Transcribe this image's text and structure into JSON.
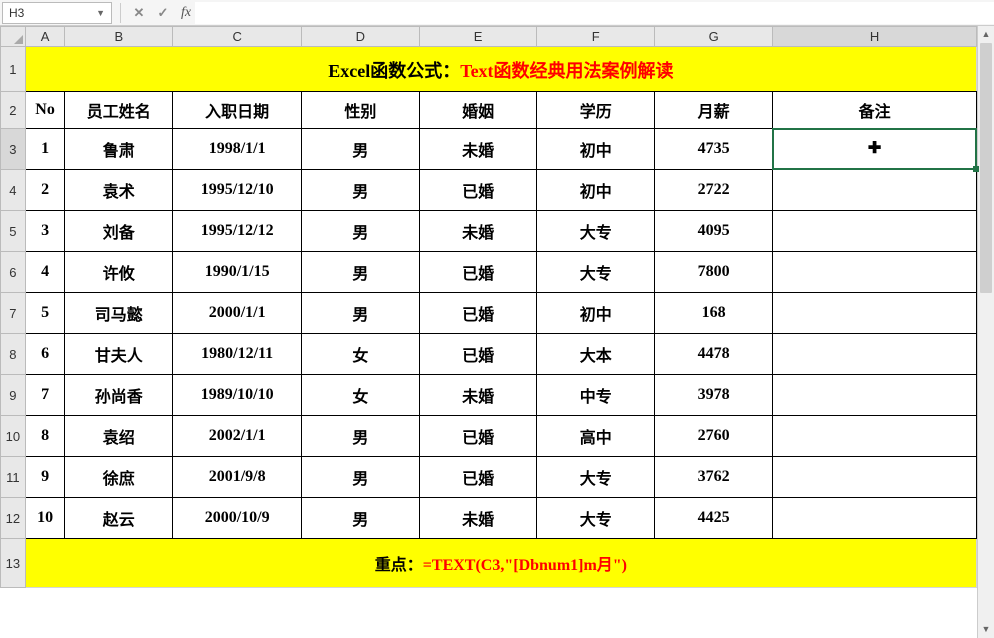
{
  "namebox": "H3",
  "formula": "",
  "columns": [
    "A",
    "B",
    "C",
    "D",
    "E",
    "F",
    "G",
    "H"
  ],
  "title_black": "Excel函数公式：",
  "title_red": "Text函数经典用法案例解读",
  "headers": [
    "No",
    "员工姓名",
    "入职日期",
    "性别",
    "婚姻",
    "学历",
    "月薪",
    "备注"
  ],
  "rows": [
    {
      "no": "1",
      "name": "鲁肃",
      "date": "1998/1/1",
      "sex": "男",
      "marriage": "未婚",
      "edu": "初中",
      "salary": "4735",
      "note": ""
    },
    {
      "no": "2",
      "name": "袁术",
      "date": "1995/12/10",
      "sex": "男",
      "marriage": "已婚",
      "edu": "初中",
      "salary": "2722",
      "note": ""
    },
    {
      "no": "3",
      "name": "刘备",
      "date": "1995/12/12",
      "sex": "男",
      "marriage": "未婚",
      "edu": "大专",
      "salary": "4095",
      "note": ""
    },
    {
      "no": "4",
      "name": "许攸",
      "date": "1990/1/15",
      "sex": "男",
      "marriage": "已婚",
      "edu": "大专",
      "salary": "7800",
      "note": ""
    },
    {
      "no": "5",
      "name": "司马懿",
      "date": "2000/1/1",
      "sex": "男",
      "marriage": "已婚",
      "edu": "初中",
      "salary": "168",
      "note": ""
    },
    {
      "no": "6",
      "name": "甘夫人",
      "date": "1980/12/11",
      "sex": "女",
      "marriage": "已婚",
      "edu": "大本",
      "salary": "4478",
      "note": ""
    },
    {
      "no": "7",
      "name": "孙尚香",
      "date": "1989/10/10",
      "sex": "女",
      "marriage": "未婚",
      "edu": "中专",
      "salary": "3978",
      "note": ""
    },
    {
      "no": "8",
      "name": "袁绍",
      "date": "2002/1/1",
      "sex": "男",
      "marriage": "已婚",
      "edu": "高中",
      "salary": "2760",
      "note": ""
    },
    {
      "no": "9",
      "name": "徐庶",
      "date": "2001/9/8",
      "sex": "男",
      "marriage": "已婚",
      "edu": "大专",
      "salary": "3762",
      "note": ""
    },
    {
      "no": "10",
      "name": "赵云",
      "date": "2000/10/9",
      "sex": "男",
      "marriage": "未婚",
      "edu": "大专",
      "salary": "4425",
      "note": ""
    }
  ],
  "footer_black": "重点：",
  "footer_red": "=TEXT(C3,\"[Dbnum1]m月\")",
  "active_col": "H",
  "active_row": 3
}
